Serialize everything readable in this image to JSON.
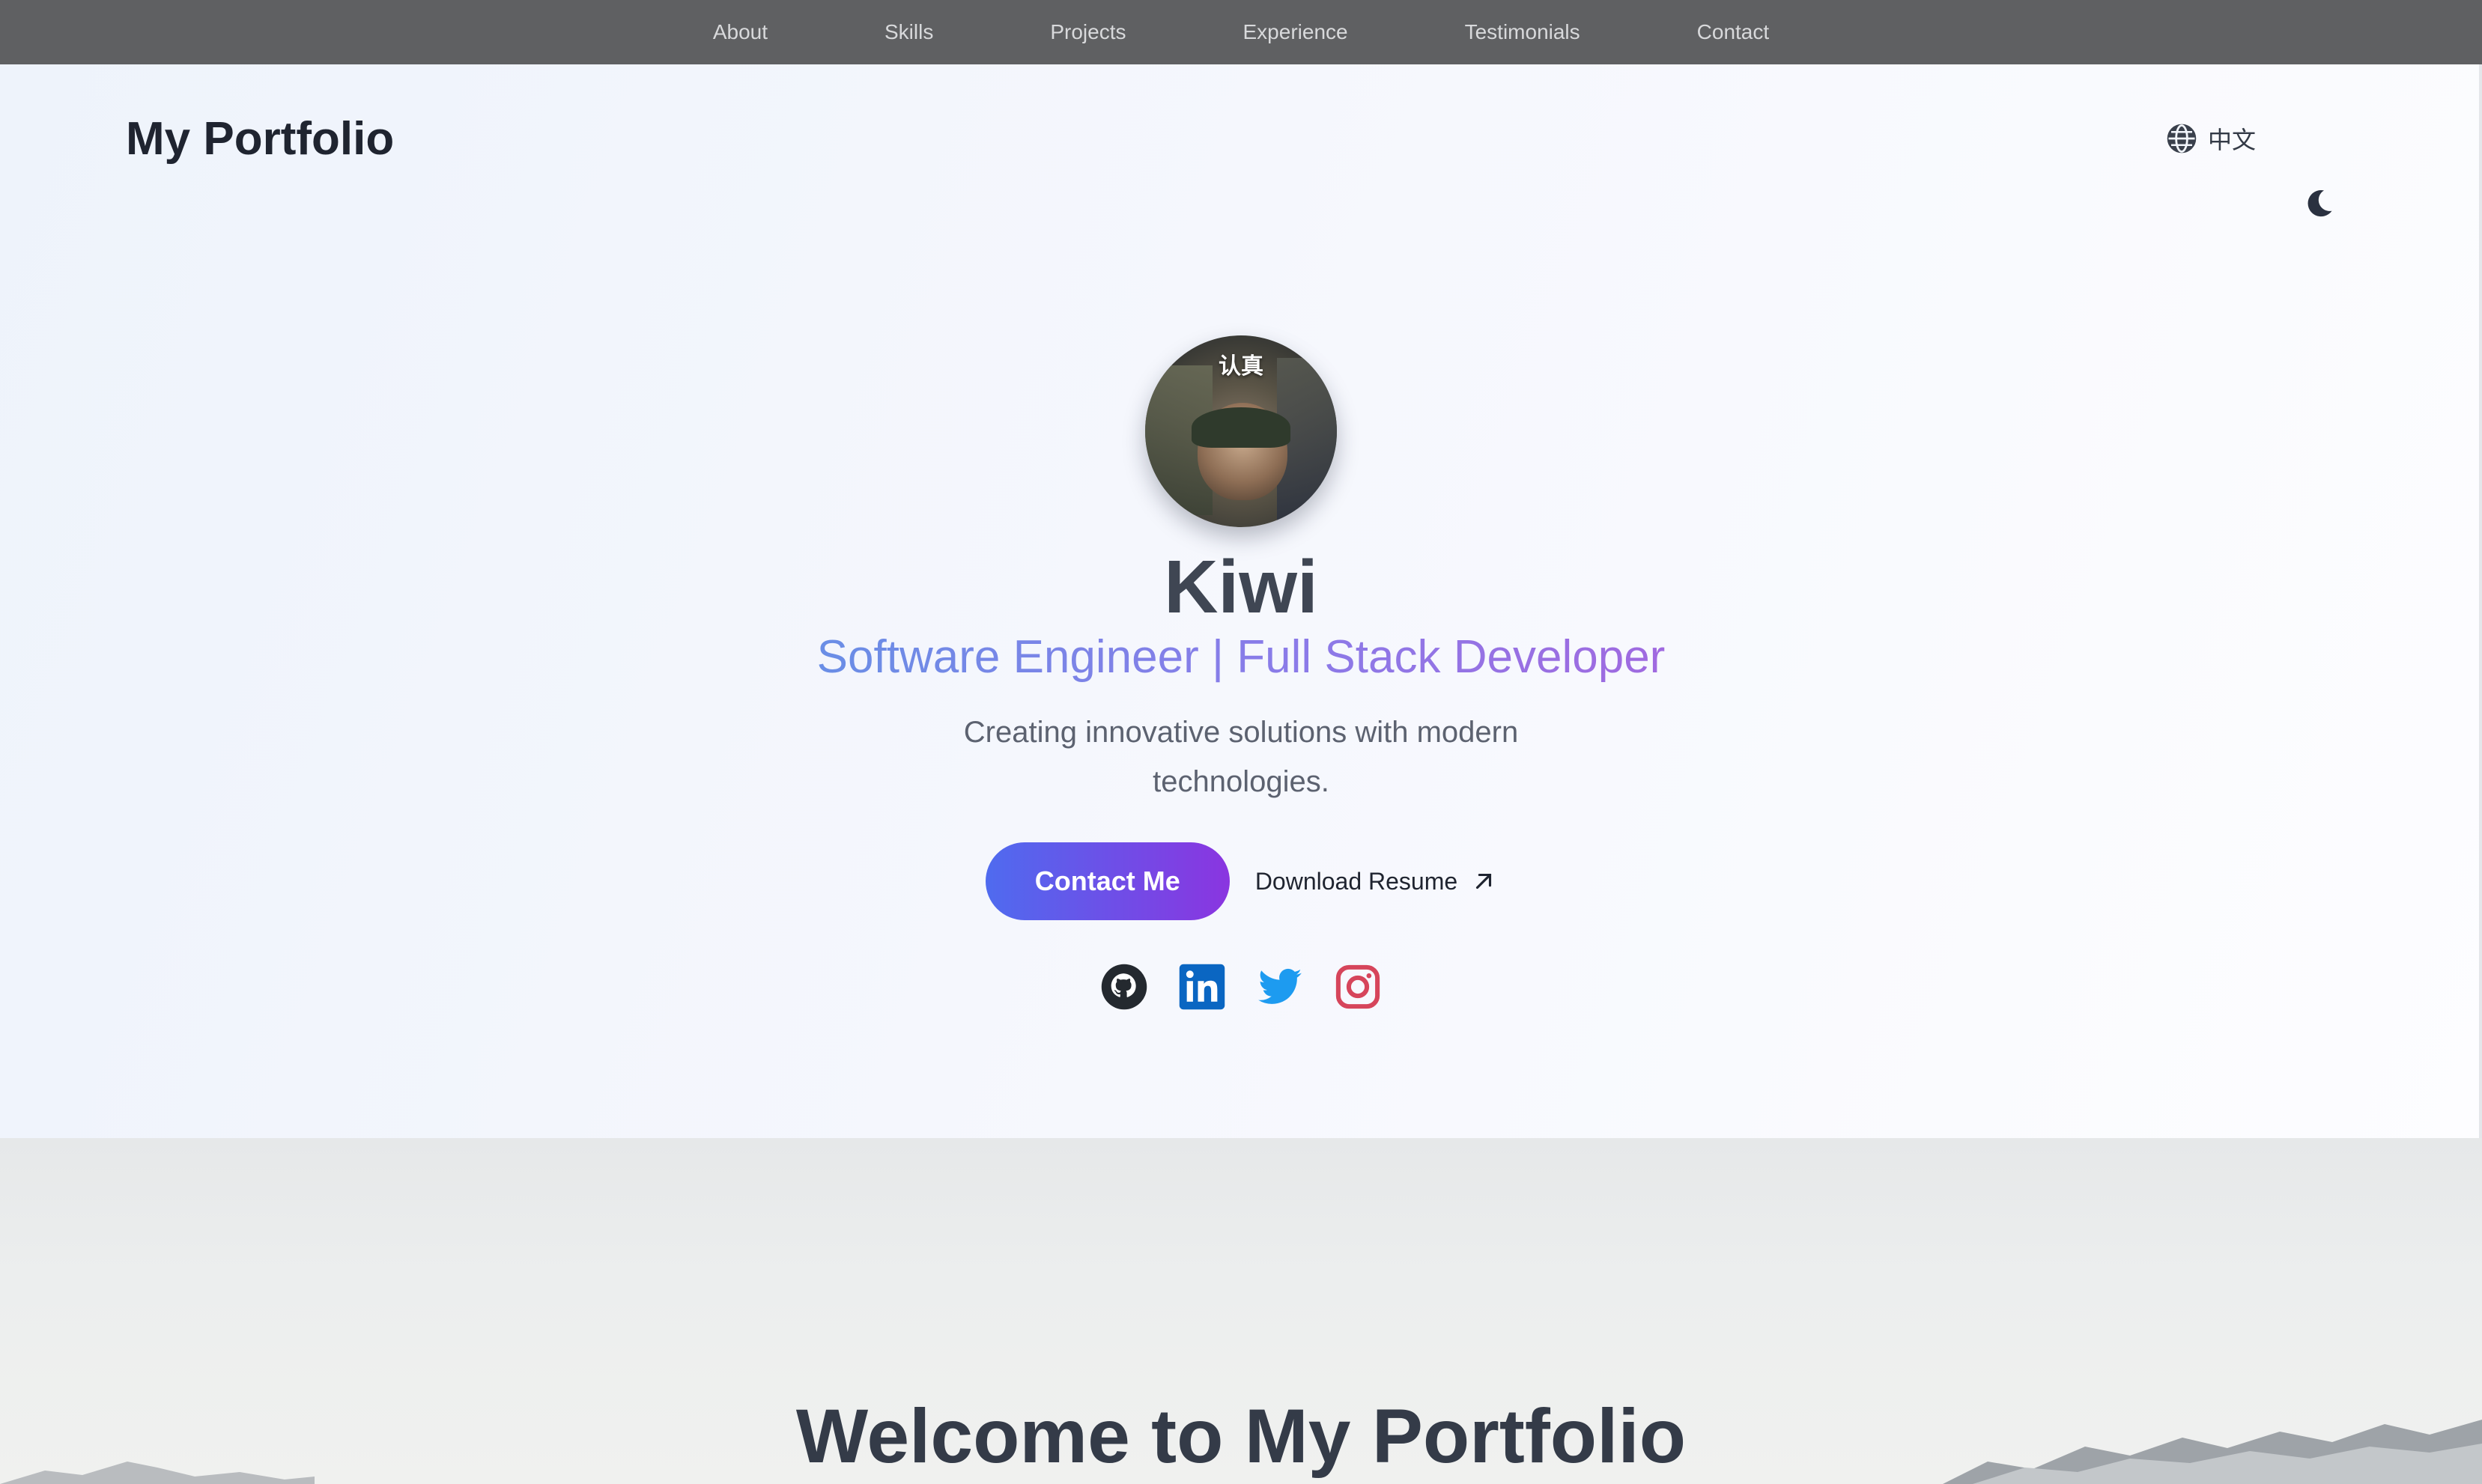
{
  "nav": {
    "items": [
      "About",
      "Skills",
      "Projects",
      "Experience",
      "Testimonials",
      "Contact"
    ]
  },
  "header": {
    "brand": "My Portfolio",
    "language_label": "中文"
  },
  "hero": {
    "avatar_caption": "认真",
    "name": "Kiwi",
    "title": "Software Engineer | Full Stack Developer",
    "description": "Creating innovative solutions with modern technologies.",
    "contact_button": "Contact Me",
    "resume_link": "Download Resume"
  },
  "socials": [
    "github-icon",
    "linkedin-icon",
    "twitter-icon",
    "instagram-icon"
  ],
  "colors": {
    "nav_bg": "#5f6062",
    "accent_start": "#4f6bef",
    "accent_end": "#8a35e0",
    "linkedin": "#0a66c2",
    "twitter": "#1d9bf0",
    "instagram": "#d6455b"
  },
  "welcome": {
    "title": "Welcome to My Portfolio"
  }
}
